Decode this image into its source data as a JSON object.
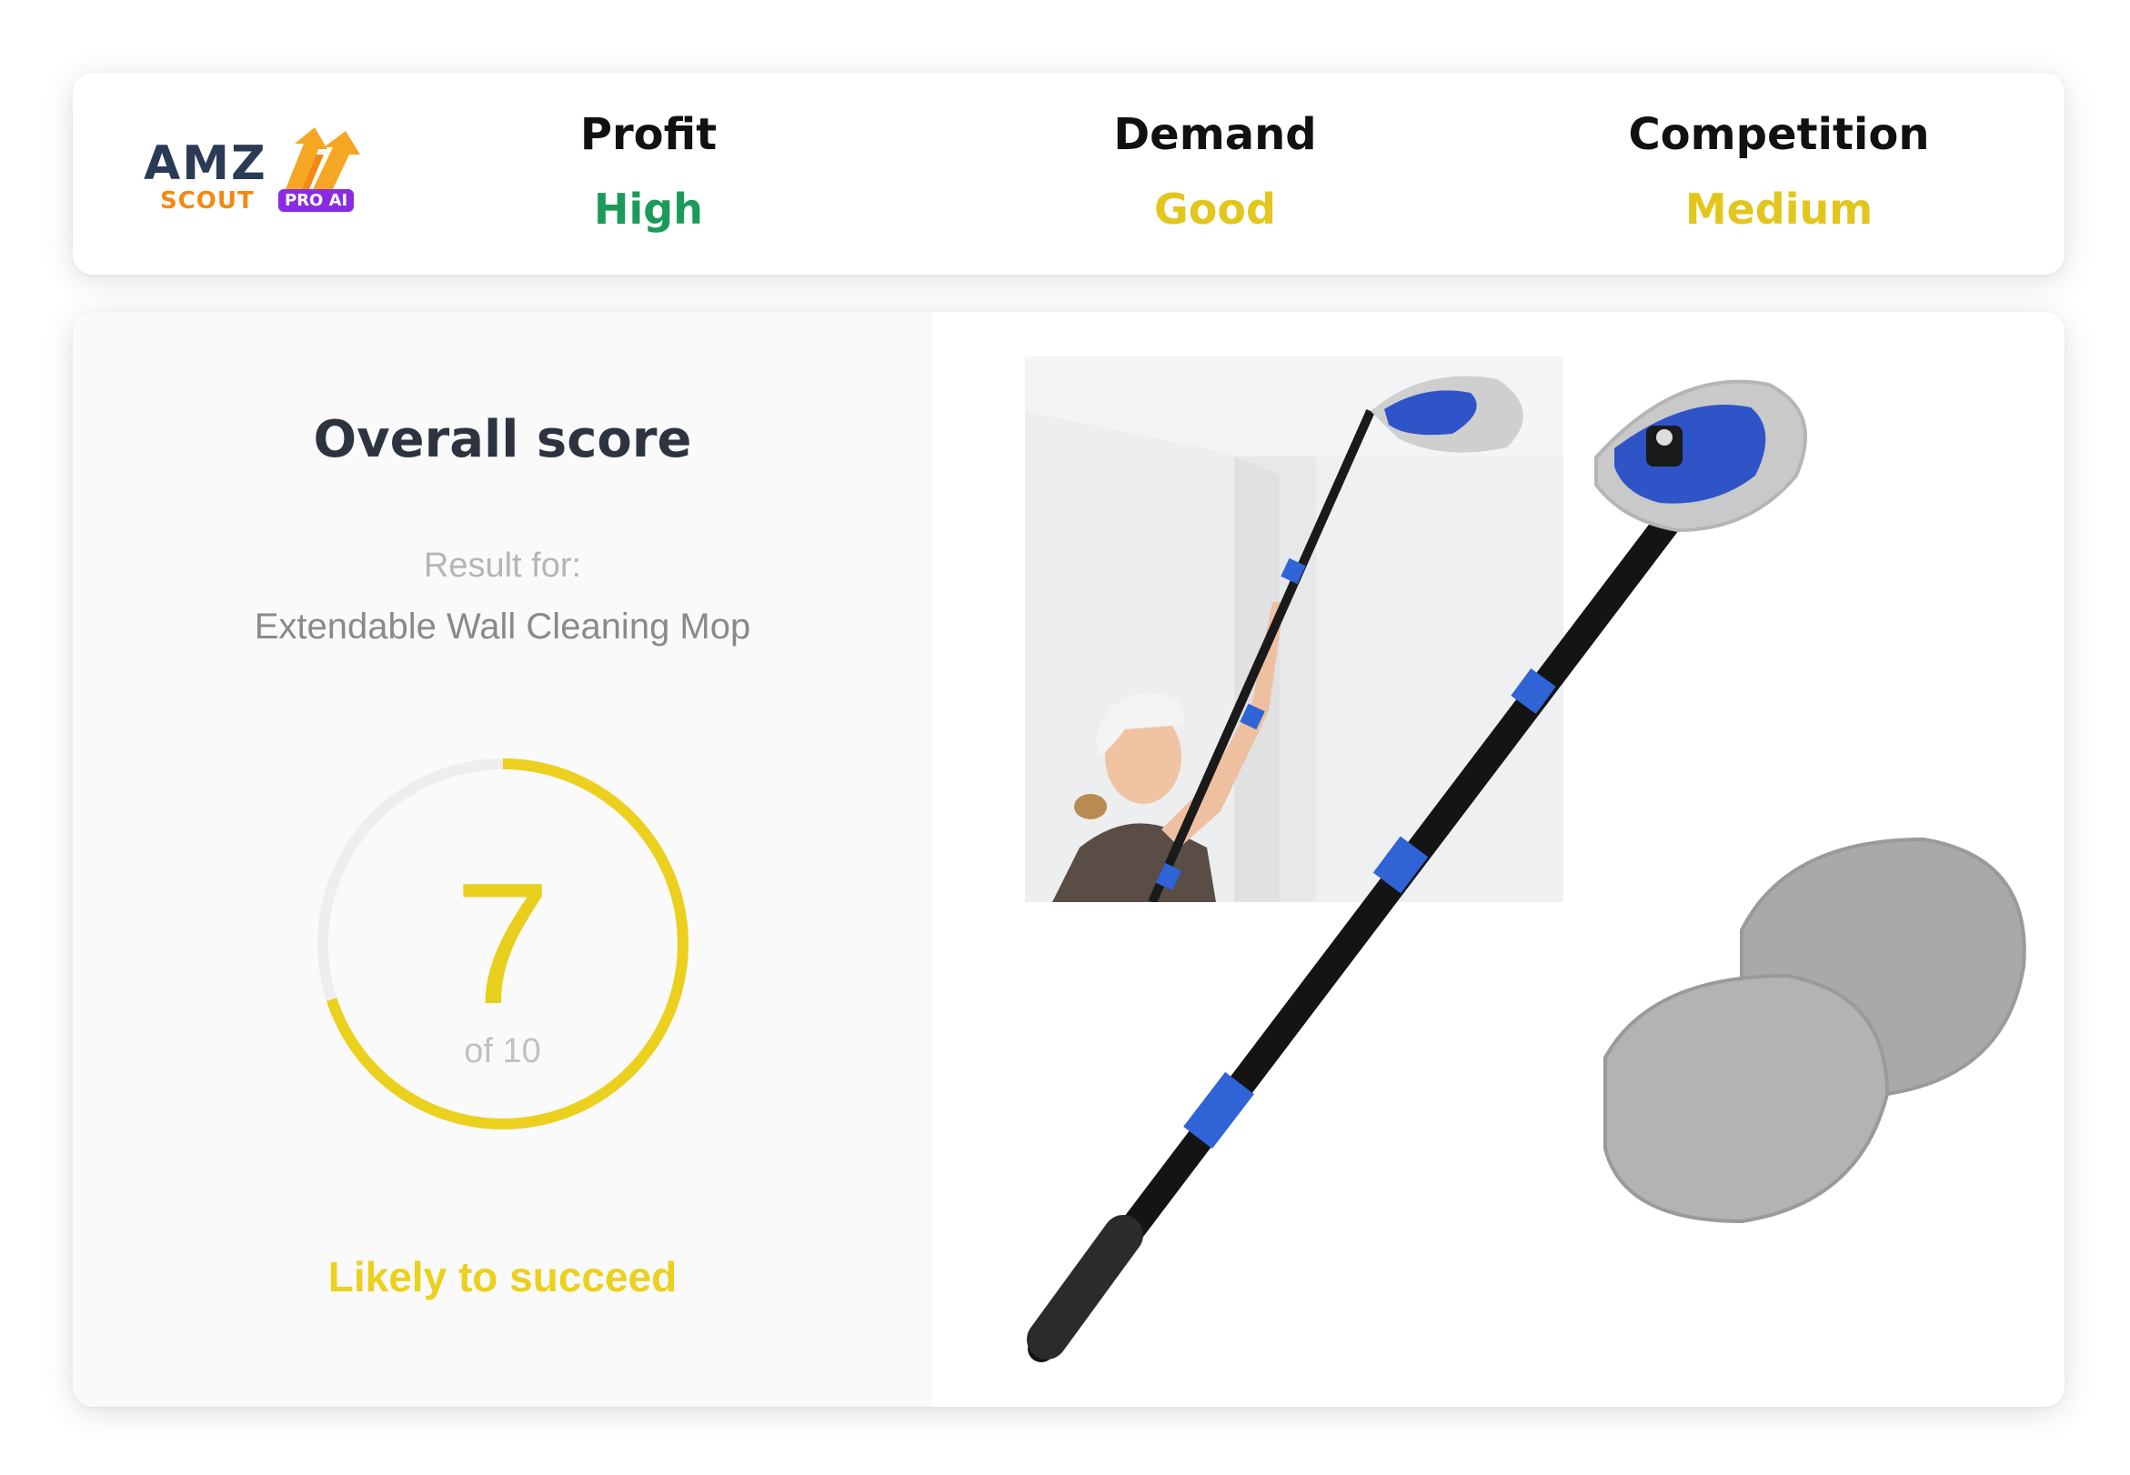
{
  "logo": {
    "brand": "AMZ",
    "sub": "SCOUT",
    "badge": "PRO AI"
  },
  "metrics": [
    {
      "label": "Profit",
      "value": "High",
      "color": "#1b9a5a"
    },
    {
      "label": "Demand",
      "value": "Good",
      "color": "#e3c61d"
    },
    {
      "label": "Competition",
      "value": "Medium",
      "color": "#e3c61d"
    }
  ],
  "score": {
    "title": "Overall score",
    "result_for": "Result for:",
    "product": "Extendable Wall Cleaning Mop",
    "value": "7",
    "of_text": "of 10",
    "fraction": 0.7,
    "verdict": "Likely to succeed",
    "accent": "#ecd01e",
    "track": "#eeeeee"
  },
  "images": {
    "lifestyle_photo": "person-cleaning-ceiling-photo",
    "product_photo": "extendable-mop-with-pads-photo"
  }
}
